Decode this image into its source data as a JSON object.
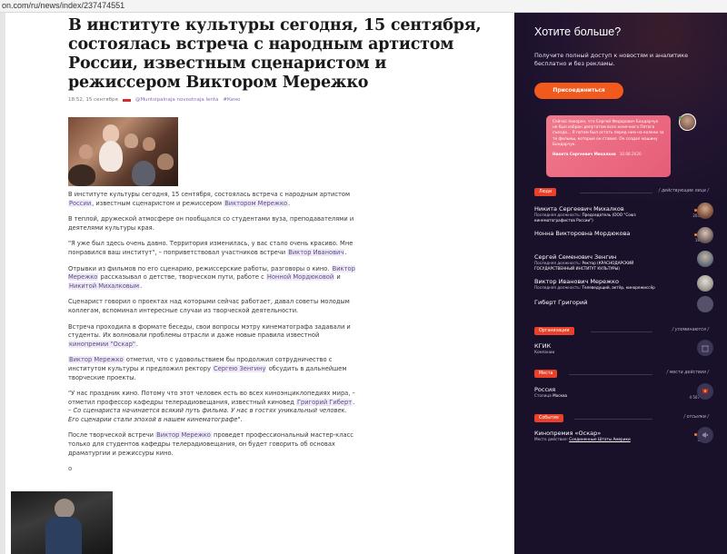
{
  "browser": {
    "url": "on.com/ru/news/index/237474551"
  },
  "article": {
    "headline": "В институте культуры сегодня, 15 сентября, состоялась встреча с народным артистом России, известным сценаристом и режиссером Виктором Мережко",
    "meta": {
      "time": "18:52, 15 сентября",
      "source": "@Muntsipalnaja novostnaja lenta",
      "rubric": "#Кино"
    },
    "paragraphs": [
      {
        "p1a": "В институте культуры сегодня, 15 сентября, состоялась встреча с народным артистом ",
        "p1b": "России",
        "p1c": ", известным сценаристом и режиссером ",
        "p1d": "Виктором Мережко",
        "p1e": "."
      }
    ],
    "p2": "В теплой, дружеской атмосфере он пообщался со студентами вуза, преподавателями и деятелями культуры края.",
    "p3a": "\"Я уже был здесь очень давно. Территория изменилась, у вас стало очень красиво. Мне понравился ваш институт\", – поприветствовал участников встречи ",
    "p3b": "Виктор Иванович",
    "p3c": ".",
    "p4a": "Отрывки из фильмов по его сценарию, режиссерские работы, разговоры о кино. ",
    "p4b": "Виктор Мережко",
    "p4c": " рассказывал о детстве, творческом пути, работе с ",
    "p4d": "Нонной Мордюковой",
    "p4e": " и ",
    "p4f": "Никитой Михалковым",
    "p4g": ".",
    "p5": "Сценарист говорил о проектах над которыми сейчас работает, давал советы молодым коллегам, вспоминал интересные случаи из творческой деятельности.",
    "p6a": "Встреча проходила в формате беседы, свои вопросы мэтру кинематографа задавали и студенты. Их волновали проблемы отрасли и даже новые правила известной ",
    "p6b": "кинопремии \"Оскар\"",
    "p6c": ".",
    "p7a": "Виктор Мережко",
    "p7b": " отметил, что с удовольствием бы продолжил сотрудничество с институтом культуры и предложил ректору ",
    "p7c": "Сергею Зенгину",
    "p7d": " обсудить в дальнейшем творческие проекты.",
    "p8a": "\"У нас праздник кино. Потому что этот человек есть во всех киноэнциклопедиях мира, – отметил профессор кафедры телерадиовещания, известный киновед ",
    "p8b": "Григорий Гиберт",
    "p8c": ". –",
    "p8d": " Со сценариста начинается всякий путь фильма. У нас в гостях уникальный человек. Его сценарии стали эпохой в нашем кинематографе",
    "p8e": "\".",
    "p9a": "После творческой встречи ",
    "p9b": "Виктор Мережко",
    "p9c": " проведет профессиональный мастер-класс только для студентов кафедры телерадиовещания, он будет говорить об основах драматургии и режиссуры кино.",
    "bullet": "o"
  },
  "sidebar": {
    "title": "Хотите больше?",
    "subtitle": "Получите полный доступ к новостям и аналитике бесплатно и без рекламы.",
    "button": "Присоединиться",
    "quote": {
      "text": "Сейчас покорен, что Сергей Федорович Бондарчук не был избран депутатом всех конечного Пятого съезда… Я потом был остать перед ним на колени за те фильмы, которые он ставил. Он создал машину Бондарчук.",
      "author": "Никита Сергеевич Михалков",
      "date": "10.08.2020"
    },
    "people": {
      "tag": "Люди",
      "right": "/ действующие лица /",
      "items": [
        {
          "name": "Никита Сергеевич Михалков",
          "desc_prefix": "Последняя должность: ",
          "desc": "Председатель (ООО \"Союз кинематографистов России\")",
          "count": "203"
        },
        {
          "name": "Нонна Викторовна Мордюкова",
          "desc_prefix": "",
          "desc": "",
          "count": "19"
        },
        {
          "name": "Сергей Семенович Зенгин",
          "desc_prefix": "Последняя должность: ",
          "desc": "Ректор (КРАСНОДАРСКИЙ ГОСУДАРСТВЕННЫЙ ИНСТИТУТ КУЛЬТУРЫ)",
          "count": ""
        },
        {
          "name": "Виктор Иванович Мережко",
          "desc_prefix": "Последняя должность: ",
          "desc": "Телеведущий, актёр, кинорежиссёр",
          "count": ""
        },
        {
          "name": "Гиберт Григорий",
          "desc_prefix": "",
          "desc": "",
          "count": ""
        }
      ]
    },
    "orgs": {
      "tag": "Организации",
      "right": "/ упоминаются /",
      "items": [
        {
          "name": "КГИК",
          "desc": "Компании"
        }
      ]
    },
    "places": {
      "tag": "Места",
      "right": "/ места действия /",
      "items": [
        {
          "name": "Россия",
          "desc_prefix": "Столица ",
          "desc": "Москва",
          "count": "4 507"
        }
      ]
    },
    "events": {
      "tag": "Событие",
      "right": "/ отсылки /",
      "items": [
        {
          "name": "Кинопремия «Оскар»",
          "desc_prefix": "Место действия: ",
          "desc": "Соединенные Штаты Америки",
          "count": "3"
        }
      ]
    }
  }
}
